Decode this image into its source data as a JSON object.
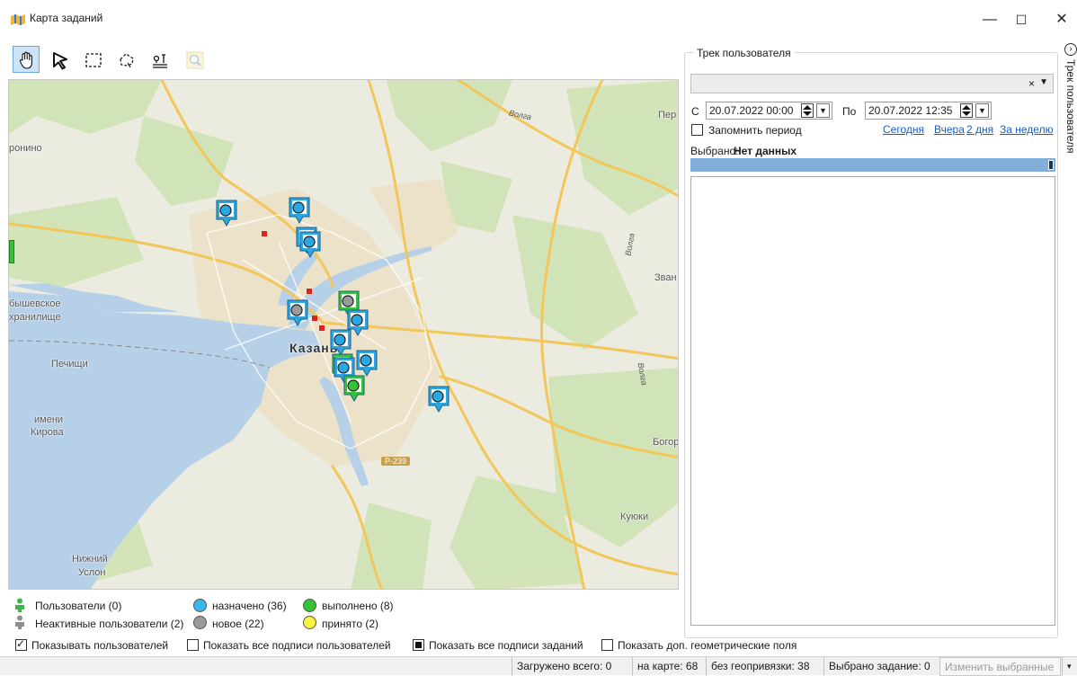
{
  "window": {
    "title": "Карта заданий",
    "minimize_glyph": "—",
    "maximize_glyph": "☐",
    "close_glyph": "✕"
  },
  "toolbar": {
    "tools": [
      "hand-pan-icon",
      "select-arrow-icon",
      "rectangle-select-icon",
      "lasso-select-icon",
      "route-icon",
      "zoom-icon"
    ],
    "active_tool": "hand-pan-icon"
  },
  "map": {
    "labels": {
      "city": "Казань",
      "place1": "ронино",
      "place2": "бышевское",
      "place3": "хранилище",
      "place4": "Печищи",
      "place5": "имени",
      "place6": "Кирова",
      "place7": "Нижний",
      "place8": "Услон",
      "place9": "Куюки",
      "place10": "Богор",
      "place11": "Зван",
      "place12": "Пер",
      "river1": "Волга",
      "river2": "Волга",
      "river3": "Волга",
      "road": "Р-239"
    },
    "marker_colors": {
      "assigned": "#2aa7e3",
      "done": "#35c235",
      "new": "#9a9a9a"
    }
  },
  "legend": {
    "users": "Пользователи (0)",
    "inactive_users": "Неактивные пользователи (2)",
    "assigned": "назначено (36)",
    "new": "новое (22)",
    "done": "выполнено (8)",
    "accepted": "принято (2)",
    "colors": {
      "assigned": "#39b6ea",
      "new": "#9a9a9a",
      "done": "#35c235",
      "accepted": "#f5f542",
      "user_active": "#3db54a",
      "user_inactive": "#8f8f8f"
    }
  },
  "options": {
    "show_users": "Показывать пользователей",
    "show_user_captions": "Показать все подписи пользователей",
    "show_task_captions": "Показать все подписи заданий",
    "show_geometry": "Показать доп. геометрические поля"
  },
  "status": {
    "loaded": "Загружено всего: 0",
    "on_map": "на карте: 68",
    "no_geo": "без геопривязки: 38",
    "selected": "Выбрано задание: 0",
    "change_button": "Изменить выбранные"
  },
  "track_panel": {
    "title": "Трек пользователя",
    "user_combo_value": "",
    "clear_glyph": "×",
    "from_label": "С",
    "from_value": "20.07.2022 00:00",
    "to_label": "По",
    "to_value": "20.07.2022 12:35",
    "remember_label": "Запомнить период",
    "links": [
      "Сегодня",
      "Вчера",
      "2 дня",
      "За неделю"
    ],
    "selected_label": "Выбрано:",
    "selected_value": "Нет данных"
  },
  "side_tab": {
    "label": "Трек пользователя"
  }
}
